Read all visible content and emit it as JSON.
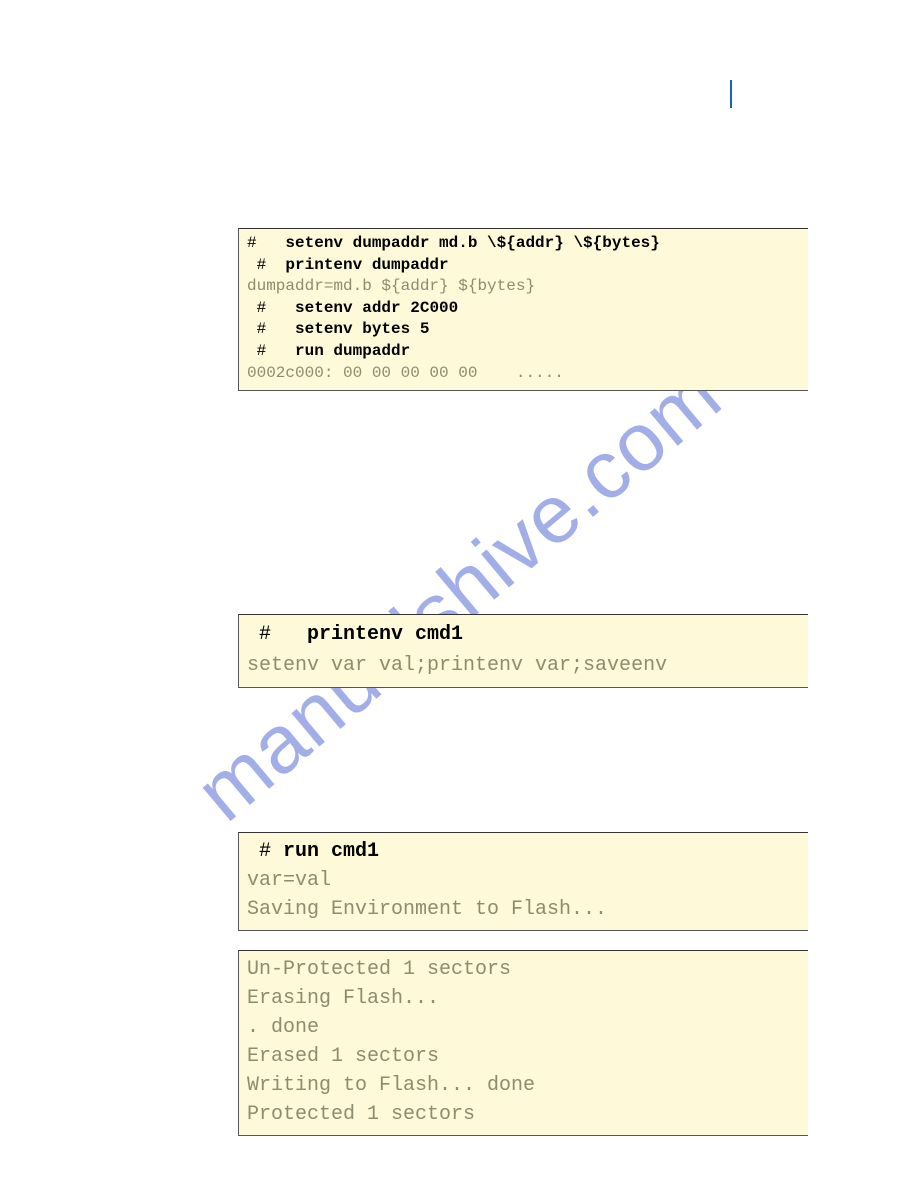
{
  "watermark": "manualshive.com",
  "block1": {
    "l1_prompt": "#   ",
    "l1_cmd": "setenv dumpaddr md.b \\${addr} \\${bytes}",
    "l2_prompt": " #  ",
    "l2_cmd": "printenv dumpaddr",
    "l3": "dumpaddr=md.b ${addr} ${bytes}",
    "l4_prompt": " #   ",
    "l4_cmd": "setenv addr 2C000",
    "l5_prompt": " #   ",
    "l5_cmd": "setenv bytes 5",
    "l6_prompt": " #   ",
    "l6_cmd": "run dumpaddr",
    "l7": "0002c000: 00 00 00 00 00    ....."
  },
  "block2": {
    "l1_prompt": " #   ",
    "l1_cmd": "printenv cmd1",
    "l2": "setenv var val;printenv var;saveenv"
  },
  "block3": {
    "l1_prompt": " # ",
    "l1_cmd": "run cmd1",
    "l2": "var=val",
    "l3": "Saving Environment to Flash..."
  },
  "block4": {
    "l1": "Un-Protected 1 sectors",
    "l2": "Erasing Flash...",
    "l3": ". done",
    "l4": "Erased 1 sectors",
    "l5": "Writing to Flash... done",
    "l6": "Protected 1 sectors"
  }
}
